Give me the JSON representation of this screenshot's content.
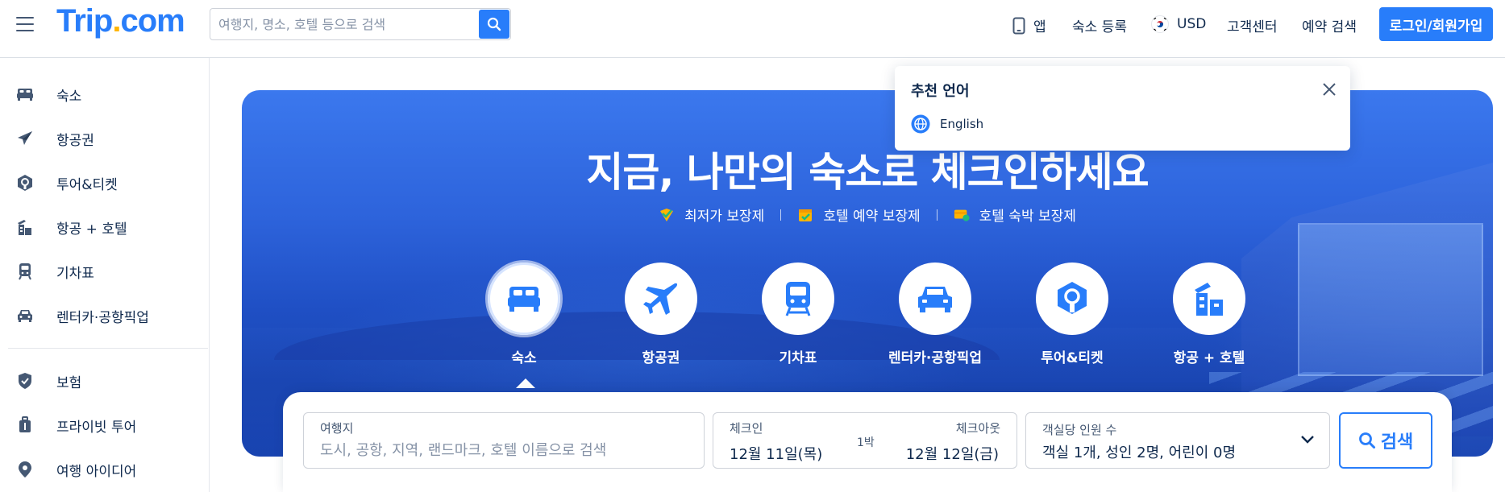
{
  "header": {
    "logo": {
      "brand": "Trip",
      "dot": ".",
      "tld": "com"
    },
    "search": {
      "placeholder": "여행지, 명소, 호텔 등으로 검색"
    },
    "nav": {
      "app": "앱",
      "list_property": "숙소 등록",
      "currency": "USD",
      "customer_service": "고객센터",
      "find_booking": "예약 검색",
      "login": "로그인/회원가입"
    }
  },
  "sidebar": {
    "items": [
      {
        "label": "숙소",
        "icon": "bed-icon"
      },
      {
        "label": "항공권",
        "icon": "plane-icon"
      },
      {
        "label": "투어&티켓",
        "icon": "ferris-wheel-icon"
      },
      {
        "label": "항공 + 호텔",
        "icon": "flight-hotel-icon"
      },
      {
        "label": "기차표",
        "icon": "train-icon"
      },
      {
        "label": "렌터카·공항픽업",
        "icon": "car-icon"
      },
      {
        "label": "보험",
        "icon": "shield-icon"
      },
      {
        "label": "프라이빗 투어",
        "icon": "luggage-icon"
      },
      {
        "label": "여행 아이디어",
        "icon": "pin-icon"
      }
    ]
  },
  "hero": {
    "title": "지금, 나만의 숙소로 체크인하세요",
    "guarantees": [
      {
        "label": "최저가 보장제",
        "icon": "check-heart-icon"
      },
      {
        "label": "호텔 예약 보장제",
        "icon": "calendar-check-icon"
      },
      {
        "label": "호텔 숙박 보장제",
        "icon": "card-shield-icon"
      }
    ],
    "categories": [
      {
        "label": "숙소",
        "icon": "bed-icon",
        "active": true
      },
      {
        "label": "항공권",
        "icon": "plane-icon"
      },
      {
        "label": "기차표",
        "icon": "train-icon"
      },
      {
        "label": "렌터카·공항픽업",
        "icon": "car-icon"
      },
      {
        "label": "투어&티켓",
        "icon": "ferris-wheel-icon"
      },
      {
        "label": "항공 + 호텔",
        "icon": "flight-hotel-icon"
      }
    ]
  },
  "search_panel": {
    "destination": {
      "label": "여행지",
      "placeholder": "도시, 공항, 지역, 랜드마크, 호텔 이름으로 검색"
    },
    "checkin": {
      "label": "체크인",
      "value": "12월 11일(목)"
    },
    "nights": "1박",
    "checkout": {
      "label": "체크아웃",
      "value": "12월 12일(금)"
    },
    "guests": {
      "label": "객실당 인원 수",
      "value": "객실 1개, 성인 2명, 어린이 0명"
    },
    "search_button": "검색"
  },
  "language_popover": {
    "title": "추천 언어",
    "option": "English"
  },
  "colors": {
    "brand_blue": "#287dfa",
    "logo_dot": "#ffb400",
    "text_dark": "#0f294d"
  }
}
